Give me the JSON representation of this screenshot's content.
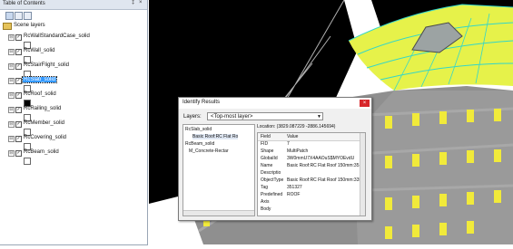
{
  "toc": {
    "title": "Table of Contents",
    "pin_glyph": "‡",
    "close_glyph": "×",
    "toolbar": [
      "list-by-drawing-order-icon",
      "list-by-source-icon",
      "list-by-visibility-icon"
    ],
    "scene_label": "Scene layers",
    "layers": [
      {
        "name": "RcWallStandardCase_solid",
        "selected": false,
        "symbol": "white"
      },
      {
        "name": "RcWall_solid",
        "selected": false,
        "symbol": "white"
      },
      {
        "name": "RcStairFlight_solid",
        "selected": false,
        "symbol": "white"
      },
      {
        "name": "RcSlab_solid",
        "selected": true,
        "symbol": "white"
      },
      {
        "name": "RcRoof_solid",
        "selected": false,
        "symbol": "black"
      },
      {
        "name": "RcRailing_solid",
        "selected": false,
        "symbol": "white"
      },
      {
        "name": "RcMember_solid",
        "selected": false,
        "symbol": "white"
      },
      {
        "name": "RcCovering_solid",
        "selected": false,
        "symbol": "white"
      },
      {
        "name": "RcBeam_solid",
        "selected": false,
        "symbol": "white"
      }
    ],
    "expand_glyph": "⊟",
    "check_glyph": "✓"
  },
  "identify": {
    "title": "Identify Results",
    "close_glyph": "×",
    "layers_label": "Layers:",
    "layers_value": "<Top-most layer>",
    "dropdown_glyph": "▼",
    "tree": [
      "RcSlab_solid",
      "Basic Roof:RC Flat Ro",
      "RcBeam_solid",
      "M_Concrete-Rectar"
    ],
    "location": "Location:  (3829.087229 -2886.145694)",
    "fields": [
      {
        "field": "Field",
        "value": "Value"
      },
      {
        "field": "FID",
        "value": "7"
      },
      {
        "field": "Shape",
        "value": "MultiPatch"
      },
      {
        "field": "GlobalId",
        "value": "3W0mmU7X4AAOuS$MYOEvdU"
      },
      {
        "field": "Name",
        "value": "Basic Roof:RC Flat Roof 150mm:351327:1"
      },
      {
        "field": "Descriptio",
        "value": ""
      },
      {
        "field": "ObjectType",
        "value": "Basic Roof:RC Flat Roof 150mm:335"
      },
      {
        "field": "Tag",
        "value": "351327"
      },
      {
        "field": "Predefined",
        "value": "ROOF"
      },
      {
        "field": "Axis",
        "value": ""
      },
      {
        "field": "Body",
        "value": ""
      }
    ]
  },
  "colors": {
    "panel_header": "#dfe6ef",
    "selection": "#3399ff",
    "roof_yellow": "#e6f24a",
    "roof_cyan": "#33d6c9",
    "wall_gray": "#8f8f8f",
    "window_yellow": "#f1ea3a",
    "close_red": "#d7262a"
  }
}
